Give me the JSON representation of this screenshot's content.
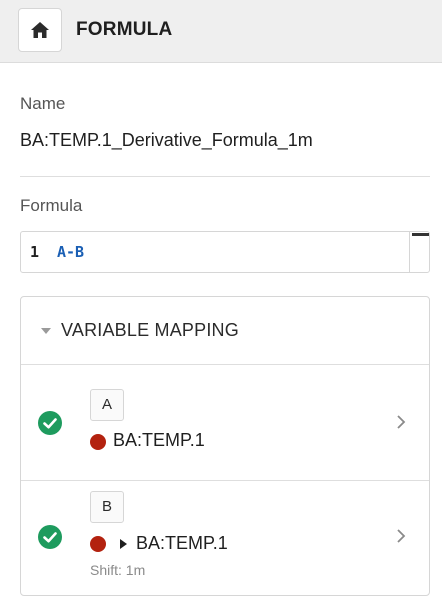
{
  "header": {
    "title": "FORMULA",
    "home_icon": "home-icon"
  },
  "name_section": {
    "label": "Name",
    "value": "BA:TEMP.1_Derivative_Formula_1m"
  },
  "formula_section": {
    "label": "Formula",
    "line_number": "1",
    "code": "A-B"
  },
  "variable_mapping": {
    "title": "VARIABLE MAPPING",
    "rows": [
      {
        "variable": "A",
        "signal": "BA:TEMP.1",
        "status_icon": "check-circle-icon",
        "signal_color": "#b3220f"
      },
      {
        "variable": "B",
        "signal": "BA:TEMP.1",
        "shift": "Shift: 1m",
        "status_icon": "check-circle-icon",
        "signal_color": "#b3220f"
      }
    ]
  },
  "colors": {
    "success": "#1e9b5e",
    "code": "#1a5fb4",
    "signal_dot": "#b3220f"
  }
}
